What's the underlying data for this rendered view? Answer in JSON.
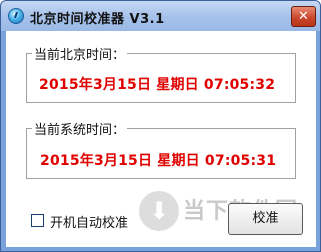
{
  "window": {
    "title": "北京时间校准器 V3.1",
    "close_glyph": "✕"
  },
  "groups": {
    "beijing": {
      "label": "当前北京时间：",
      "value": "2015年3月15日  星期日  07:05:32"
    },
    "system": {
      "label": "当前系统时间：",
      "value": "2015年3月15日  星期日  07:05:31"
    }
  },
  "options": {
    "autostart_label": "开机自动校准",
    "autostart_checked": false
  },
  "actions": {
    "calibrate_label": "校准"
  },
  "watermark": {
    "text": "当下软件园",
    "icon": "download-arrow-icon"
  },
  "colors": {
    "time_text": "#e00000",
    "titlebar": "#a5c1ea",
    "close_button": "#c8442a"
  }
}
